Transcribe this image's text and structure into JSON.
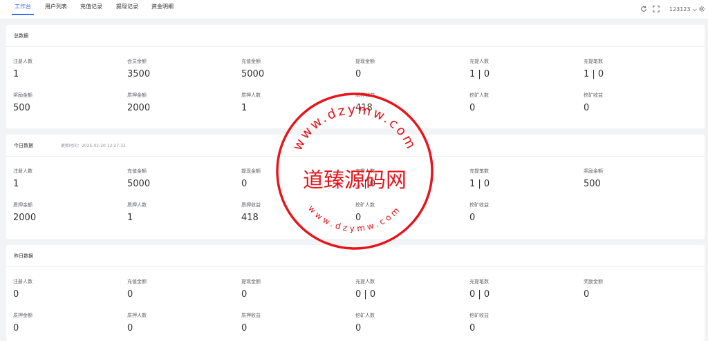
{
  "tabs": [
    {
      "label": "工作台",
      "active": true
    },
    {
      "label": "用户列表",
      "active": false
    },
    {
      "label": "充值记录",
      "active": false
    },
    {
      "label": "提现记录",
      "active": false
    },
    {
      "label": "资金明细",
      "active": false
    }
  ],
  "header": {
    "username": "123123",
    "icons": [
      "refresh-icon",
      "fullscreen-icon",
      "chevron-down-icon",
      "gear-icon"
    ]
  },
  "colors": {
    "accent": "#3b6cf6",
    "stamp": "#e8141b"
  },
  "sections": [
    {
      "title": "总数据",
      "stats": [
        {
          "label": "注册人数",
          "value": "1"
        },
        {
          "label": "会员余额",
          "value": "3500"
        },
        {
          "label": "充值金额",
          "value": "5000"
        },
        {
          "label": "提现金额",
          "value": "0"
        },
        {
          "label": "充提人数",
          "value": "1 | 0"
        },
        {
          "label": "充提笔数",
          "value": "1 | 0"
        },
        {
          "label": "奖励金额",
          "value": "500"
        },
        {
          "label": "质押金额",
          "value": "2000"
        },
        {
          "label": "质押人数",
          "value": "1"
        },
        {
          "label": "质押收益",
          "value": "418"
        },
        {
          "label": "挖矿人数",
          "value": "0"
        },
        {
          "label": "挖矿收益",
          "value": "0"
        }
      ]
    },
    {
      "title": "今日数据",
      "subtitle": "更新时间：2025-02-20 12:27:33",
      "stats": [
        {
          "label": "注册人数",
          "value": "1"
        },
        {
          "label": "充值金额",
          "value": "5000"
        },
        {
          "label": "提现金额",
          "value": "0"
        },
        {
          "label": "充提人数",
          "value": "1 | 0"
        },
        {
          "label": "充提笔数",
          "value": "1 | 0"
        },
        {
          "label": "奖励金额",
          "value": "500"
        },
        {
          "label": "质押金额",
          "value": "2000"
        },
        {
          "label": "质押人数",
          "value": "1"
        },
        {
          "label": "质押收益",
          "value": "418"
        },
        {
          "label": "挖矿人数",
          "value": "0"
        },
        {
          "label": "挖矿收益",
          "value": "0"
        }
      ]
    },
    {
      "title": "昨日数据",
      "stats": [
        {
          "label": "注册人数",
          "value": "0"
        },
        {
          "label": "充值金额",
          "value": "0"
        },
        {
          "label": "提现金额",
          "value": "0"
        },
        {
          "label": "充提人数",
          "value": "0 | 0"
        },
        {
          "label": "充提笔数",
          "value": "0 | 0"
        },
        {
          "label": "奖励金额",
          "value": "0"
        },
        {
          "label": "质押金额",
          "value": "0"
        },
        {
          "label": "质押人数",
          "value": "0"
        },
        {
          "label": "质押收益",
          "value": "0"
        },
        {
          "label": "挖矿人数",
          "value": "0"
        },
        {
          "label": "挖矿收益",
          "value": "0"
        }
      ]
    }
  ],
  "watermark": {
    "center_text": "道臻源码网",
    "ring_text": "www.dzymw.com"
  }
}
